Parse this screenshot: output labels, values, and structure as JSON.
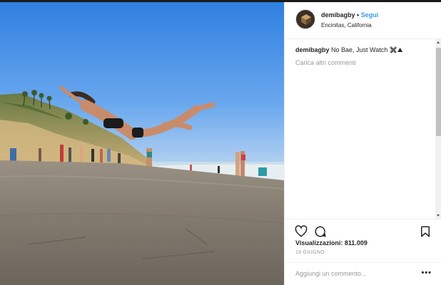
{
  "post": {
    "username": "demibagby",
    "separator": "•",
    "follow_label": "Segui",
    "location": "Encinitas, California",
    "caption_user": "demibagby",
    "caption_text": "No Bae, Just Watch ✖️⛰",
    "load_more": "Carica altri commenti",
    "views_label": "Visualizzazioni:",
    "views_count": "811.009",
    "date": "16 GIUGNO",
    "add_comment_placeholder": "Aggiungi un commento...",
    "more_options": "•••"
  },
  "icons": [
    "heart-icon",
    "comment-icon",
    "bookmark-icon",
    "more-options-icon"
  ],
  "colors": {
    "link": "#3897f0",
    "text": "#262626",
    "muted": "#999999"
  }
}
